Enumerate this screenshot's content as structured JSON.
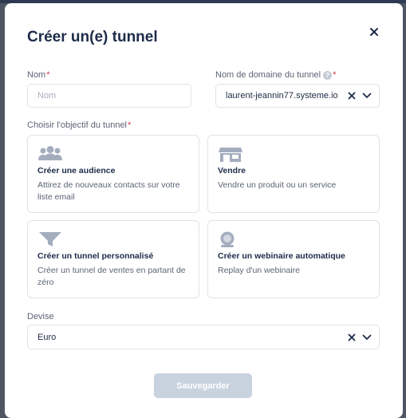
{
  "modal": {
    "title": "Créer un(e) tunnel",
    "close_icon": "close-icon"
  },
  "name_field": {
    "label": "Nom",
    "placeholder": "Nom",
    "value": ""
  },
  "domain_field": {
    "label": "Nom de domaine du tunnel",
    "help_icon": "help-icon",
    "help_glyph": "?",
    "value": "laurent-jeannin77.systeme.io"
  },
  "goal": {
    "label": "Choisir l'objectif du tunnel",
    "options": [
      {
        "title": "Créer une audience",
        "description": "Attirez de nouveaux contacts sur votre liste email",
        "icon": "audience-icon"
      },
      {
        "title": "Vendre",
        "description": "Vendre un produit ou un service",
        "icon": "store-icon"
      },
      {
        "title": "Créer un tunnel personnalisé",
        "description": "Créer un tunnel de ventes en partant de zéro",
        "icon": "funnel-icon"
      },
      {
        "title": "Créer un webinaire automatique",
        "description": "Replay d'un webinaire",
        "icon": "webinar-icon"
      }
    ]
  },
  "currency": {
    "label": "Devise",
    "value": "Euro"
  },
  "required_mark": "*",
  "save_label": "Sauvegarder",
  "colors": {
    "accent_disabled": "#c9d2df",
    "required": "#d5374a",
    "icon": "#a3adbd"
  }
}
